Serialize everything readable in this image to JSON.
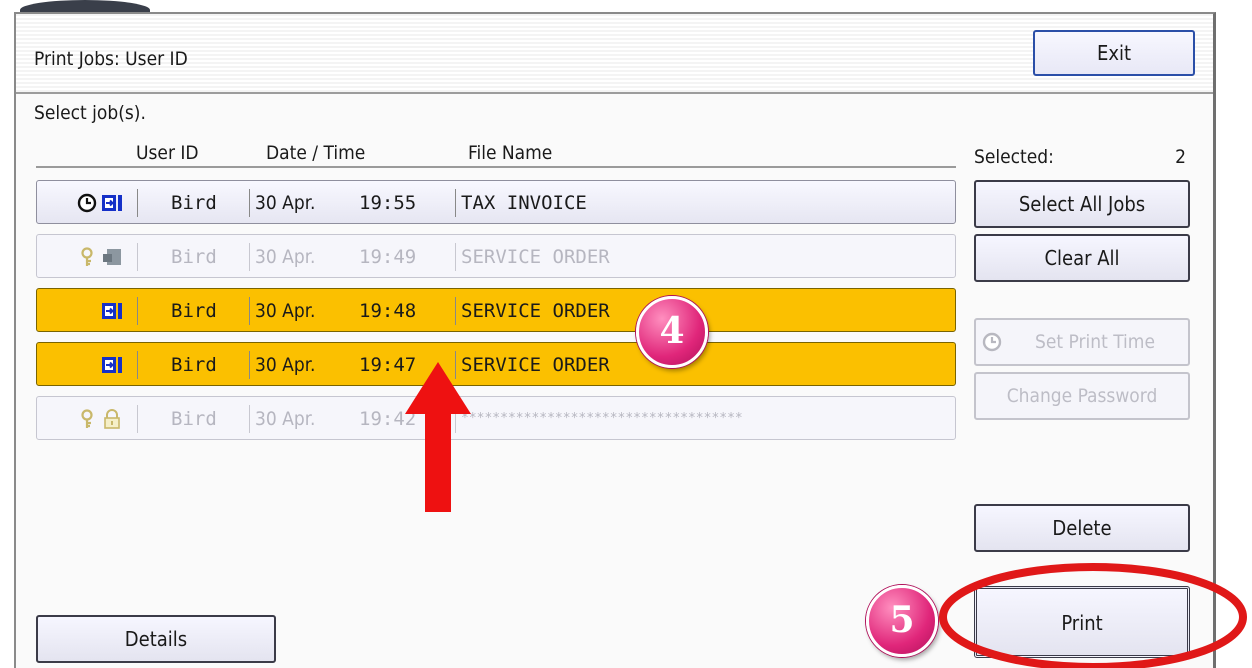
{
  "header": {
    "title": "Print Jobs: User ID",
    "exit_label": "Exit"
  },
  "prompt": "Select job(s).",
  "columns": [
    "User ID",
    "Date / Time",
    "File Name"
  ],
  "jobs": [
    {
      "user": "Bird",
      "date": "30 Apr.",
      "time": "19:55",
      "file": "TAX INVOICE",
      "state": "normal",
      "icons": [
        "clock-icon",
        "print-job-icon"
      ]
    },
    {
      "user": "Bird",
      "date": "30 Apr.",
      "time": "19:49",
      "file": "SERVICE ORDER",
      "state": "disabled",
      "icons": [
        "key-icon",
        "stored-job-icon"
      ]
    },
    {
      "user": "Bird",
      "date": "30 Apr.",
      "time": "19:48",
      "file": "SERVICE ORDER",
      "state": "selected",
      "icons": [
        "print-job-icon"
      ]
    },
    {
      "user": "Bird",
      "date": "30 Apr.",
      "time": "19:47",
      "file": "SERVICE ORDER",
      "state": "selected",
      "icons": [
        "print-job-icon"
      ]
    },
    {
      "user": "Bird",
      "date": "30 Apr.",
      "time": "19:42",
      "file": "************************************",
      "state": "disabled",
      "icons": [
        "key-icon",
        "lock-icon"
      ]
    }
  ],
  "selection": {
    "label": "Selected:",
    "count": "2"
  },
  "buttons": {
    "select_all": "Select All Jobs",
    "clear_all": "Clear All",
    "set_print_time": "Set Print Time",
    "change_password": "Change Password",
    "delete": "Delete",
    "print": "Print",
    "details": "Details"
  },
  "callouts": {
    "step4": "4",
    "step5": "5"
  },
  "colors": {
    "selected_row": "#fbc000",
    "accent_blue": "#2b4fa8",
    "callout_pink": "#e0267a",
    "arrow_red": "#ee1111"
  }
}
